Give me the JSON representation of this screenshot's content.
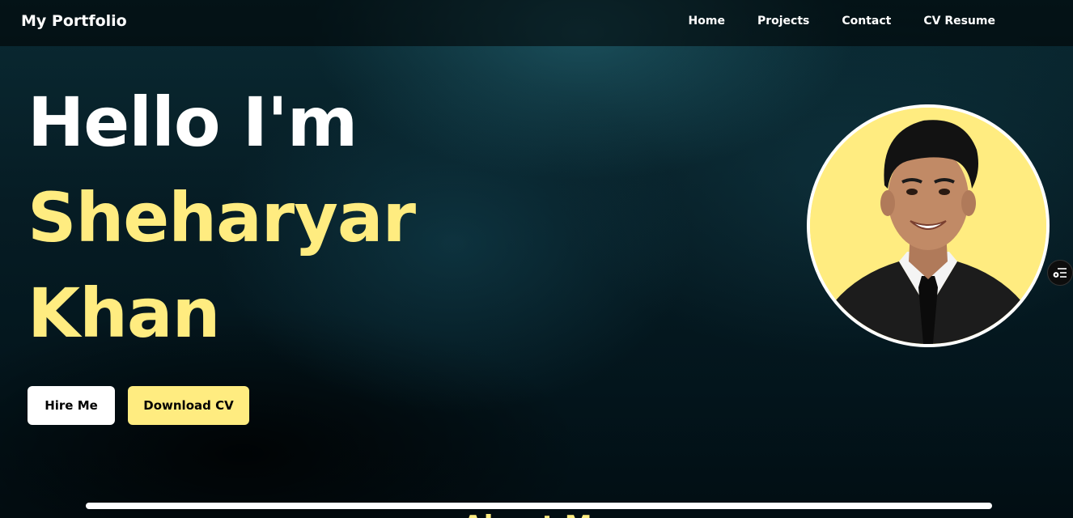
{
  "navbar": {
    "brand": "My Portfolio",
    "links": [
      "Home",
      "Projects",
      "Contact",
      "CV Resume"
    ]
  },
  "hero": {
    "greeting": "Hello I'm",
    "first_name": "Sheharyar",
    "last_name": "Khan",
    "hire_label": "Hire Me",
    "download_label": "Download CV"
  },
  "about": {
    "title": "About Me"
  },
  "colors": {
    "accent": "#ffec80",
    "text": "#ffffff",
    "background": "#03151c"
  },
  "icons": {
    "side_toggle": "sliders-icon"
  }
}
